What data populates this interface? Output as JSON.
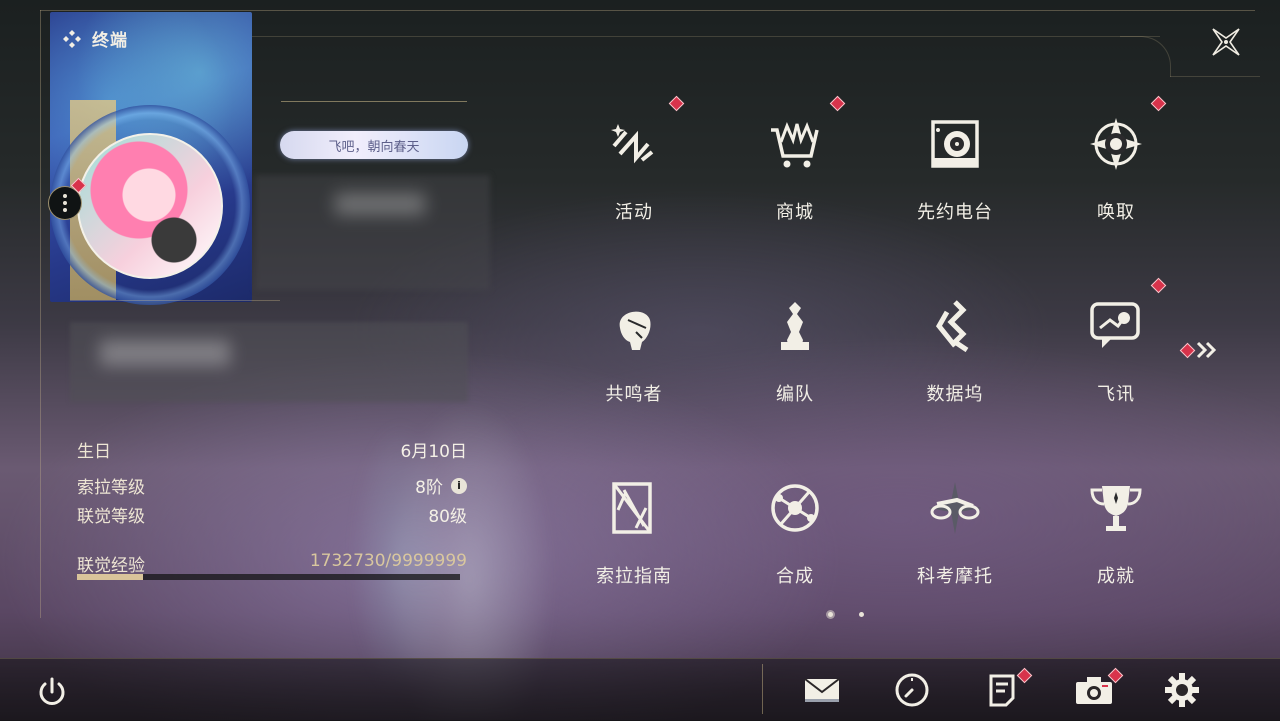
{
  "header": {
    "title": "终端",
    "icon": "diamond-cluster-icon"
  },
  "close": {
    "icon": "close-x-icon"
  },
  "profile": {
    "signature": "飞吧，朝向春天",
    "stats": [
      {
        "label": "生日",
        "value": "6月10日"
      },
      {
        "label": "索拉等级",
        "value": "8阶"
      },
      {
        "label": "联觉等级",
        "value": "80级"
      }
    ],
    "exp": {
      "label": "联觉经验",
      "value": "1732730/9999999",
      "progress": 0.173
    }
  },
  "menu": [
    {
      "label": "活动",
      "icon": "activity-icon",
      "badge": true
    },
    {
      "label": "商城",
      "icon": "shop-cart-icon",
      "badge": true
    },
    {
      "label": "先约电台",
      "icon": "radio-icon",
      "badge": false
    },
    {
      "label": "唤取",
      "icon": "convene-star-icon",
      "badge": true
    },
    {
      "label": "共鸣者",
      "icon": "resonator-icon",
      "badge": false
    },
    {
      "label": "编队",
      "icon": "team-chess-icon",
      "badge": false
    },
    {
      "label": "数据坞",
      "icon": "databank-icon",
      "badge": false
    },
    {
      "label": "飞讯",
      "icon": "message-icon",
      "badge": true
    },
    {
      "label": "索拉指南",
      "icon": "guide-icon",
      "badge": false
    },
    {
      "label": "合成",
      "icon": "synthesis-icon",
      "badge": false
    },
    {
      "label": "科考摩托",
      "icon": "motorbike-icon",
      "badge": false
    },
    {
      "label": "成就",
      "icon": "trophy-icon",
      "badge": false
    }
  ],
  "pager": {
    "pages": 2,
    "current": 1
  },
  "bottom": [
    {
      "name": "mail",
      "icon": "mail-icon",
      "badge": false
    },
    {
      "name": "history",
      "icon": "clock-icon",
      "badge": false
    },
    {
      "name": "notice",
      "icon": "notice-doc-icon",
      "badge": true
    },
    {
      "name": "screenshot",
      "icon": "camera-icon",
      "badge": true
    },
    {
      "name": "settings",
      "icon": "gear-icon",
      "badge": false
    }
  ],
  "colors": {
    "badge": "#d8334b",
    "gold": "#d9c49a",
    "text": "#f2efe6"
  }
}
